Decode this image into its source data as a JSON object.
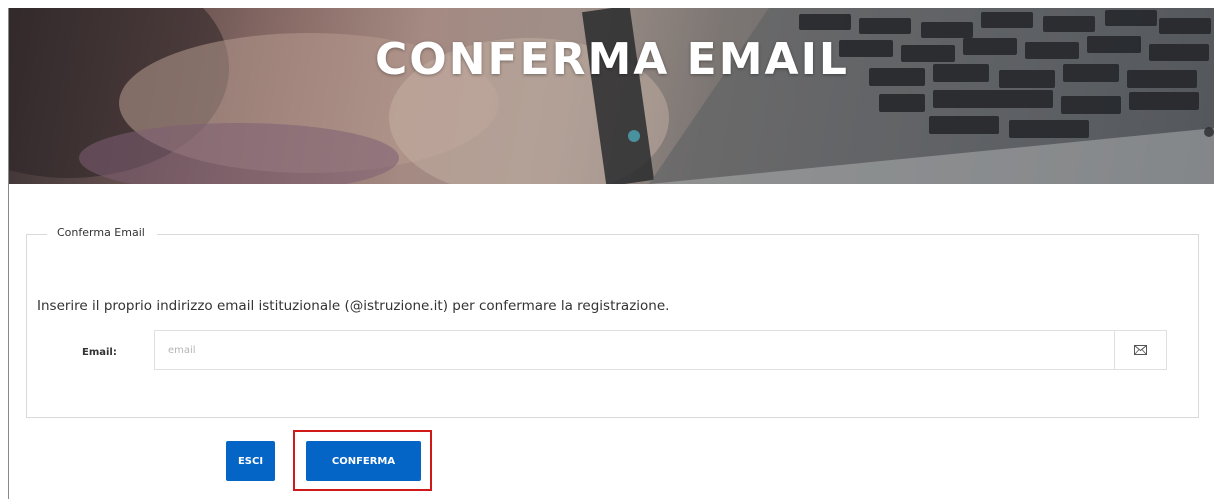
{
  "banner": {
    "title": "CONFERMA EMAIL"
  },
  "form": {
    "legend": "Conferma Email",
    "instructions": "Inserire il proprio indirizzo email istituzionale (@istruzione.it) per confermare la registrazione.",
    "email_label": "Email:",
    "email_placeholder": "email",
    "email_value": "",
    "email_addon_icon": "envelope-icon"
  },
  "actions": {
    "exit_label": "ESCI",
    "confirm_label": "CONFERMA"
  },
  "colors": {
    "button_primary": "#0565c6",
    "highlight_border": "#d01a1a"
  }
}
